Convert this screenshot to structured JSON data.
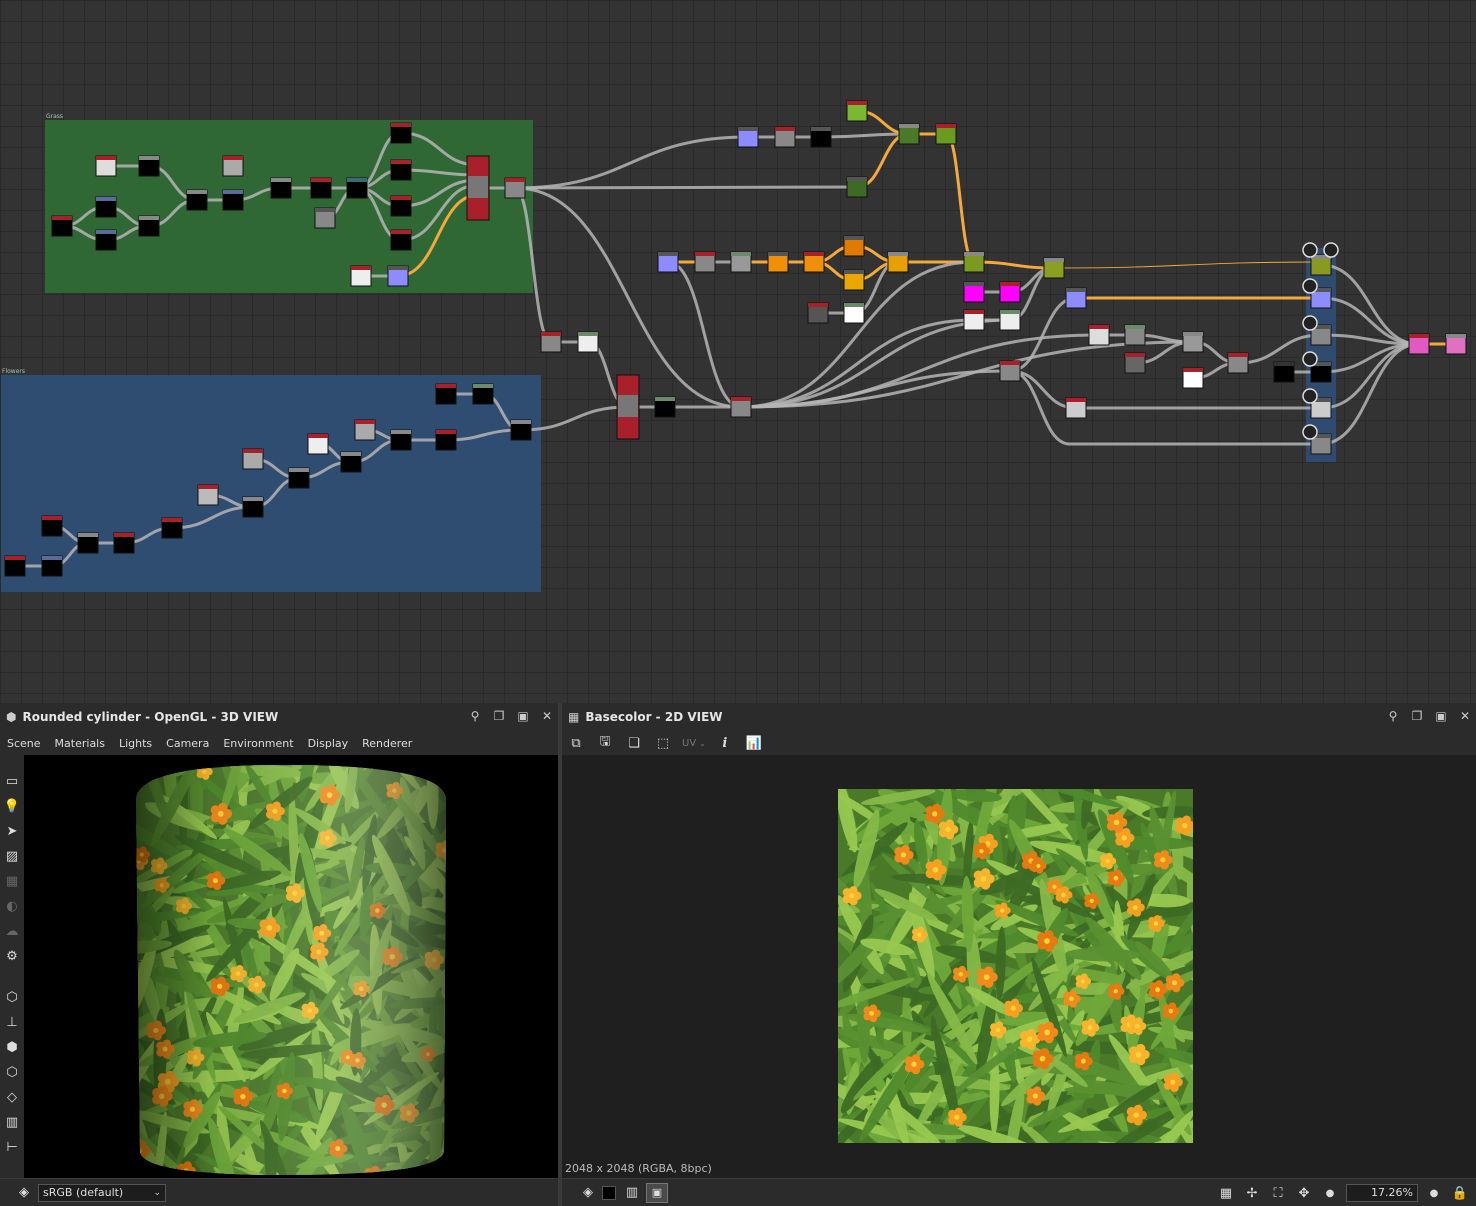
{
  "graph": {
    "frames": [
      {
        "name": "grass-frame",
        "label": "Grass",
        "color": "#2f6b35"
      },
      {
        "name": "flowers-frame",
        "label": "Flowers",
        "color": "#2f4e75"
      }
    ]
  },
  "view3d": {
    "title": "Rounded cylinder - OpenGL - 3D VIEW",
    "menu": [
      "Scene",
      "Materials",
      "Lights",
      "Camera",
      "Environment",
      "Display",
      "Renderer"
    ],
    "colorspace": "sRGB (default)",
    "side_tools": [
      "camera-icon",
      "light-icon",
      "cursor-icon",
      "environment-icon",
      "grid-icon",
      "shadow-icon",
      "cloud-icon",
      "settings-icon",
      "box-wire-icon",
      "axis-icon",
      "cube-icon",
      "cube-wire-icon",
      "layers-icon",
      "chart-icon",
      "tree-icon"
    ]
  },
  "view2d": {
    "title": "Basecolor - 2D VIEW",
    "uv_label": "UV",
    "info": "2048 x 2048 (RGBA, 8bpc)",
    "zoom": "17.26%"
  },
  "colors": {
    "accent_orange": "#f3a93b",
    "link_gray": "#b5b5b5",
    "node_red": "#a8202a",
    "panel_bg": "#2b2b2b"
  }
}
